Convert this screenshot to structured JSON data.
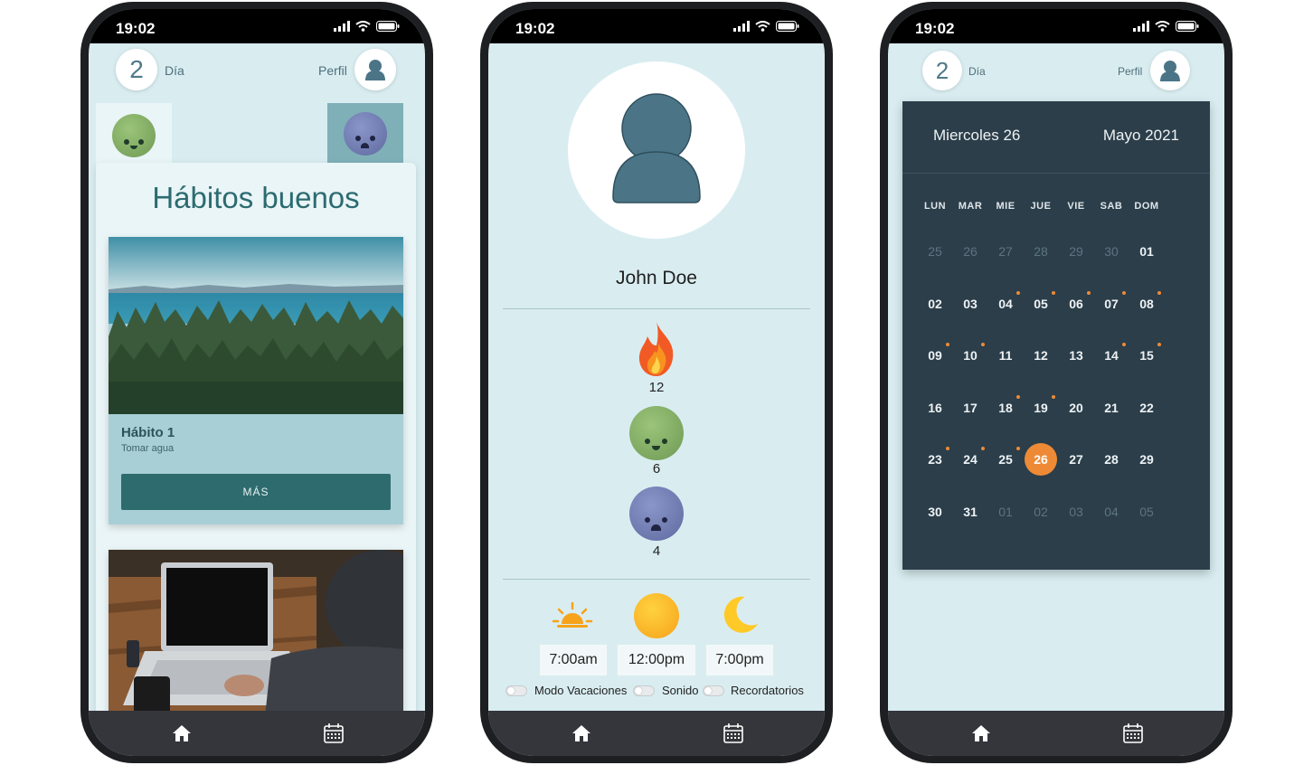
{
  "status": {
    "time": "19:02"
  },
  "screen1": {
    "day_number": "2",
    "day_label": "Día",
    "profile_label": "Perfil",
    "title": "Hábitos buenos",
    "habit": {
      "name": "Hábito 1",
      "subtitle": "Tomar agua",
      "button": "MÁS"
    }
  },
  "screen2": {
    "user_name": "John Doe",
    "stats": [
      {
        "icon": "fire-icon",
        "value": "12"
      },
      {
        "icon": "happy-face-icon",
        "value": "6"
      },
      {
        "icon": "sad-face-icon",
        "value": "4"
      }
    ],
    "times": [
      {
        "icon": "sunrise-icon",
        "value": "7:00am"
      },
      {
        "icon": "sun-icon",
        "value": "12:00pm"
      },
      {
        "icon": "moon-icon",
        "value": "7:00pm"
      }
    ],
    "toggles": [
      "Modo Vacaciones",
      "Sonido",
      "Recordatorios"
    ]
  },
  "screen3": {
    "day_number": "2",
    "day_label": "Día",
    "profile_label": "Perfil",
    "calendar": {
      "selected_label": "Miercoles 26",
      "month_label": "Mayo 2021",
      "weekdays": [
        "LUN",
        "MAR",
        "MIE",
        "JUE",
        "VIE",
        "SAB",
        "DOM"
      ],
      "weeks": [
        [
          "25",
          "26",
          "27",
          "28",
          "29",
          "30",
          "01"
        ],
        [
          "02",
          "03",
          "04",
          "05",
          "06",
          "07",
          "08"
        ],
        [
          "09",
          "10",
          "11",
          "12",
          "13",
          "14",
          "15"
        ],
        [
          "16",
          "17",
          "18",
          "19",
          "20",
          "21",
          "22"
        ],
        [
          "23",
          "24",
          "25",
          "26",
          "27",
          "28",
          "29"
        ],
        [
          "30",
          "31",
          "01",
          "02",
          "03",
          "04",
          "05"
        ]
      ],
      "selected_day": "26"
    }
  },
  "colors": {
    "accent": "#ee8a36",
    "teal": "#2e6b6e",
    "background": "#d9edf1",
    "calendar_bg": "#2b3e4a"
  }
}
